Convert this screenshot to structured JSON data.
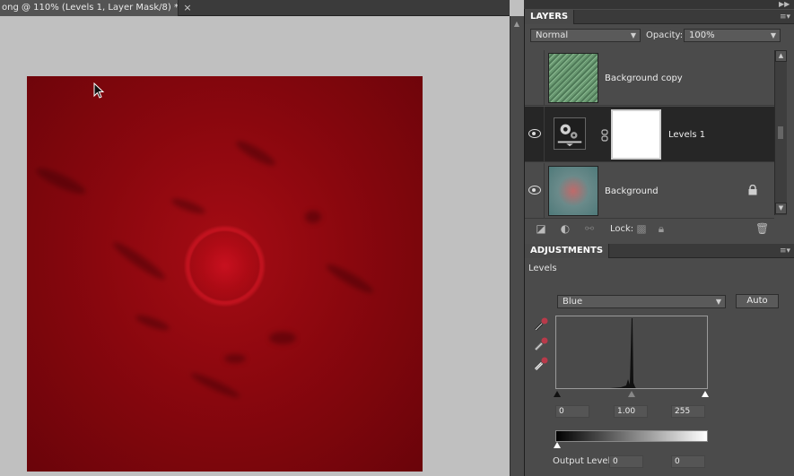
{
  "document": {
    "tab_title": "ong @ 110% (Levels 1, Layer Mask/8) *",
    "close_glyph": "×"
  },
  "layers_panel": {
    "title": "LAYERS",
    "blend_mode": "Normal",
    "opacity_label": "Opacity:",
    "opacity_value": "100%",
    "layers": [
      {
        "name": "Background copy",
        "visible": false
      },
      {
        "name": "Levels 1",
        "visible": true,
        "selected": true
      },
      {
        "name": "Background",
        "visible": true,
        "locked": true
      }
    ],
    "lock_label": "Lock:"
  },
  "adjustments_panel": {
    "title": "ADJUSTMENTS",
    "type_label": "Levels",
    "channel": "Blue",
    "auto_label": "Auto",
    "input_black": "0",
    "input_gamma": "1.00",
    "input_white": "255",
    "output_label": "Output Levels:",
    "output_black": "0",
    "output_white": "0"
  },
  "colors": {
    "panel_bg": "#4b4b4b",
    "canvas_bg": "#c0c0c0",
    "image_red": "#8a070e",
    "selected_row": "#2a2a2a"
  }
}
